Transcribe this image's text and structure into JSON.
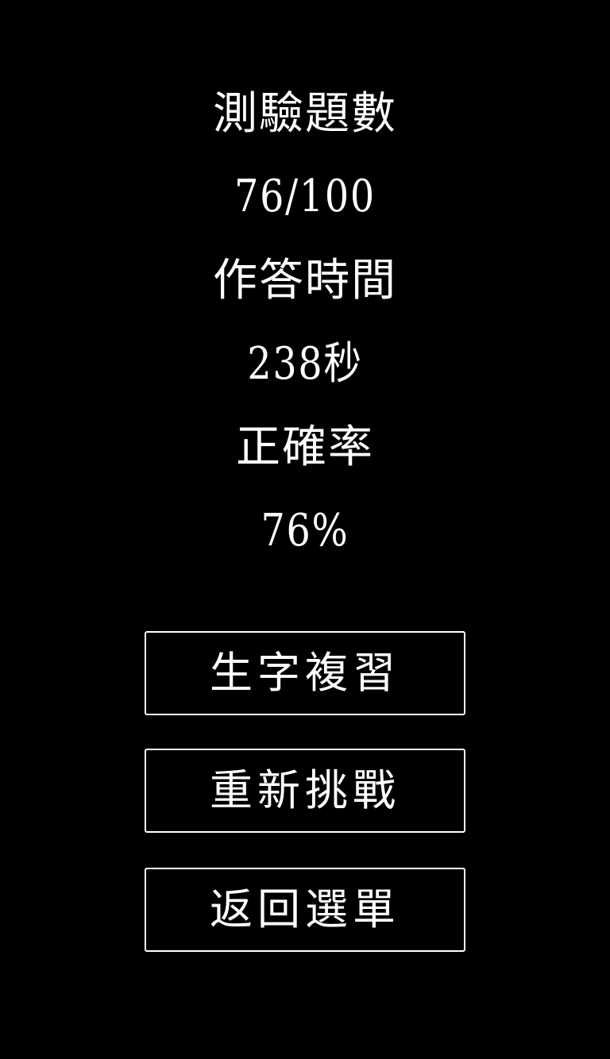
{
  "results": {
    "questions_label": "測驗題數",
    "questions_value": "76/100",
    "time_label": "作答時間",
    "time_value": "238秒",
    "accuracy_label": "正確率",
    "accuracy_value": "76%"
  },
  "actions": {
    "review_label": "生字複習",
    "retry_label": "重新挑戰",
    "menu_label": "返回選單"
  },
  "colors": {
    "background": "#000000",
    "text": "#ffffff",
    "button_border": "#ffffff"
  }
}
